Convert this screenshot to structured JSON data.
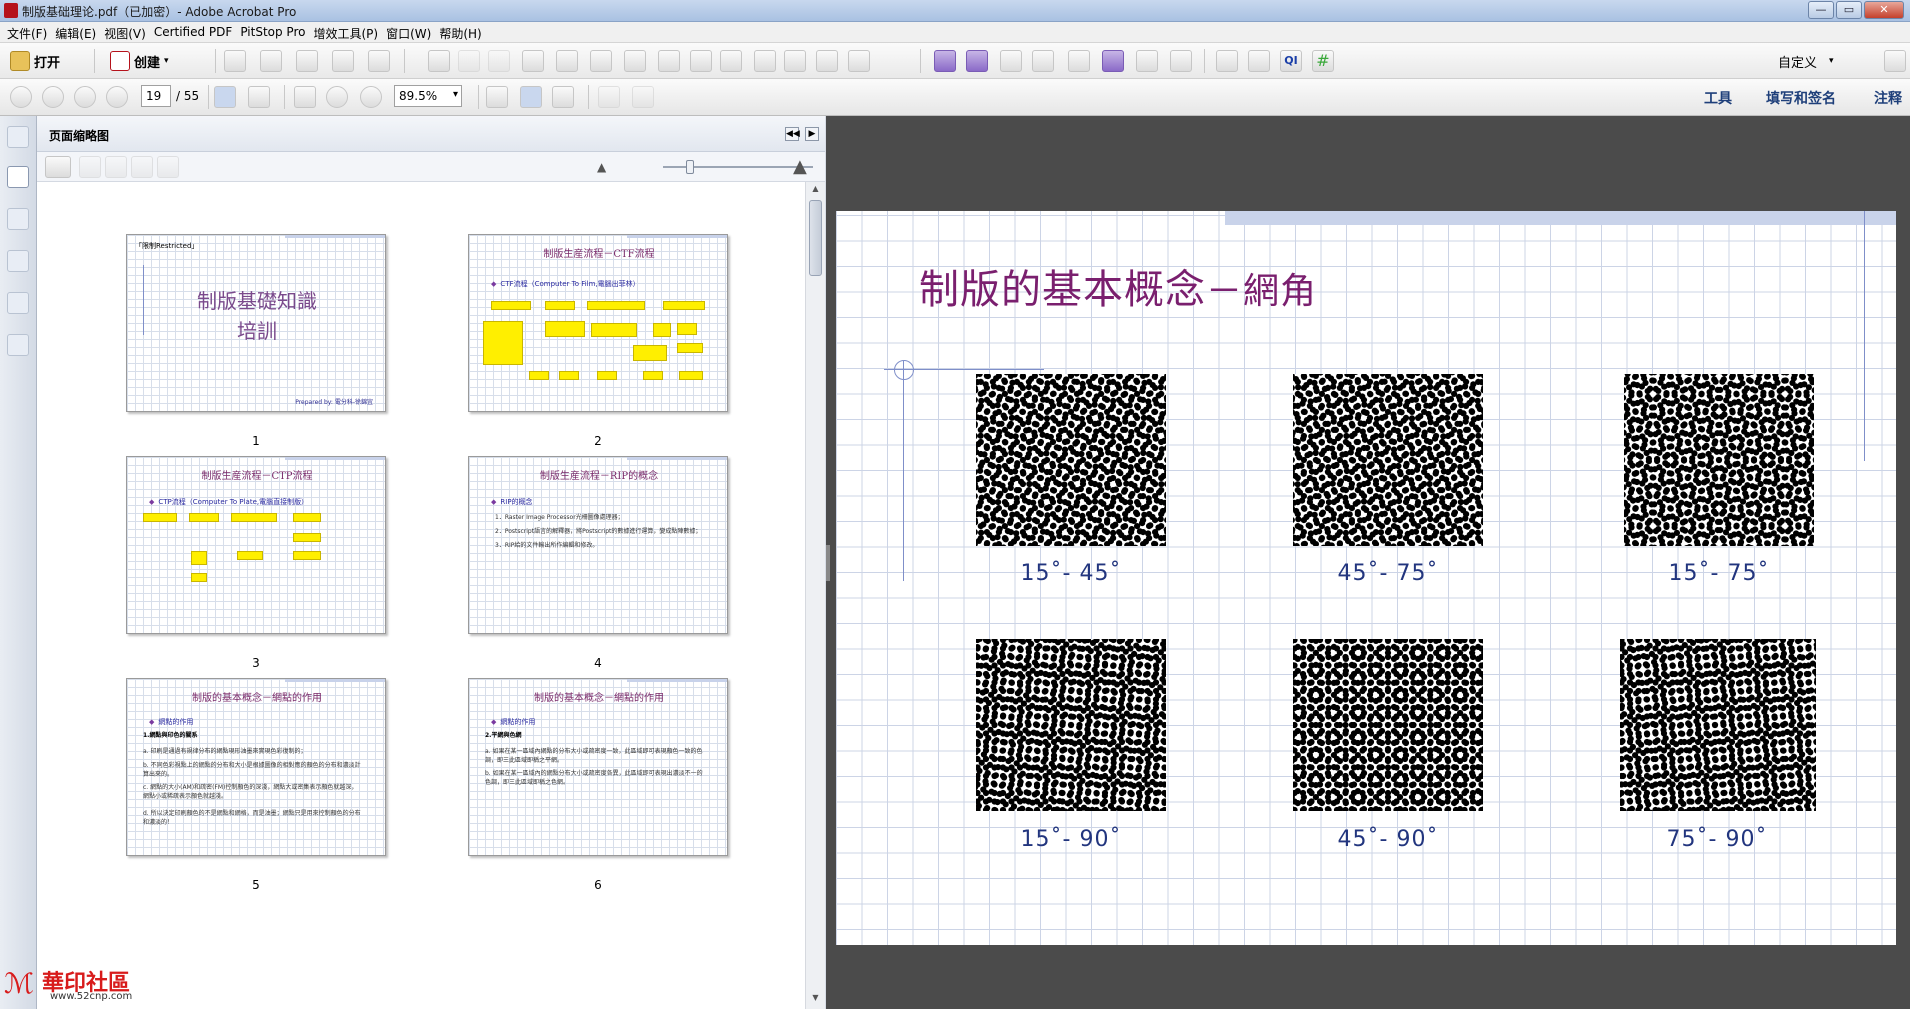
{
  "window": {
    "title": "制版基础理论.pdf（已加密）- Adobe Acrobat Pro",
    "min": "—",
    "max": "▭",
    "close": "✕"
  },
  "menu": [
    "文件(F)",
    "编辑(E)",
    "视图(V)",
    "Certified PDF",
    "PitStop Pro",
    "增效工具(P)",
    "窗口(W)",
    "帮助(H)"
  ],
  "toolbar": {
    "open_label": "打开",
    "create_label": "创建",
    "customize_label": "自定义"
  },
  "nav": {
    "current_page": "19",
    "total_pages": "/ 55",
    "zoom": "89.5%"
  },
  "right_links": {
    "tools": "工具",
    "fill_sign": "填写和签名",
    "comment": "注释"
  },
  "panel": {
    "title": "页面缩略图"
  },
  "thumbnails": [
    {
      "num": "1",
      "title": "制版基礎知識",
      "title2": "培訓",
      "tag": "「限制Restricted」",
      "footer": "Prepared by: 電分科-徐錦宜"
    },
    {
      "num": "2",
      "title": "制版生産流程－CTF流程",
      "sub": "CTF流程（Computer To Film,電腦出菲林）"
    },
    {
      "num": "3",
      "title": "制版生産流程－CTP流程",
      "sub": "CTP流程（Computer To Plate,電腦直接制版）"
    },
    {
      "num": "4",
      "title": "制版生産流程－RIP的概念",
      "sub": "RIP的概念",
      "lines": [
        "1．Raster Image Processor光柵圖像處理器；",
        "2．Postscript語言的解釋器，將Postscript的數據進行運算，變成點陣數據；",
        "3．RIP給的文件輸出所作編輯和修改。"
      ]
    },
    {
      "num": "5",
      "title": "制版的基本概念－網點的作用",
      "sub": "網點的作用",
      "h": "1.網點與印色的關系",
      "lines": [
        "a. 印刷是通過有規律分布的網點現形油墨來實現色彩復制的；",
        "b. 不同色彩視點上的網點的分布和大小是根據圖像的相對應的顏色的分布和濃淡計算出來的。",
        "c. 網點的大小(AM)和疏密(FM)控制顏色的深淺，網點大或密集表示顏色就越深，網點小或稀疏表示顏色就越淺。",
        "d. 所以決定印刷顏色的不是網點和網格，而是油墨；網點只是用來控制顏色的分布和濃淡的！"
      ]
    },
    {
      "num": "6",
      "title": "制版的基本概念－網點的作用",
      "sub": "網點的作用",
      "h": "2.平網與色網",
      "lines": [
        "a. 如果在某一區域內網點的分布大小或疏密度一致，此區域即可表現顏色一致的色調，即三此區域即稱之平網。",
        "b. 如果在某一區域內的網點分布大小或疏密度各異，此區域即可表現出濃淡不一的色調，即三此區域即稱之色網。"
      ]
    }
  ],
  "slide": {
    "title_main": "制版的基本概念",
    "title_sub": "－網角",
    "labels": [
      "15˚- 45˚",
      "45˚- 75˚",
      "15˚- 75˚",
      "15˚- 90˚",
      "45˚- 90˚",
      "75˚- 90˚"
    ]
  },
  "watermark": {
    "text": "華印社區",
    "url": "www.52cnp.com"
  },
  "colors": {
    "title_purple": "#7a1f6e",
    "label_blue": "#22357e",
    "grid": "#ccd4e6"
  }
}
